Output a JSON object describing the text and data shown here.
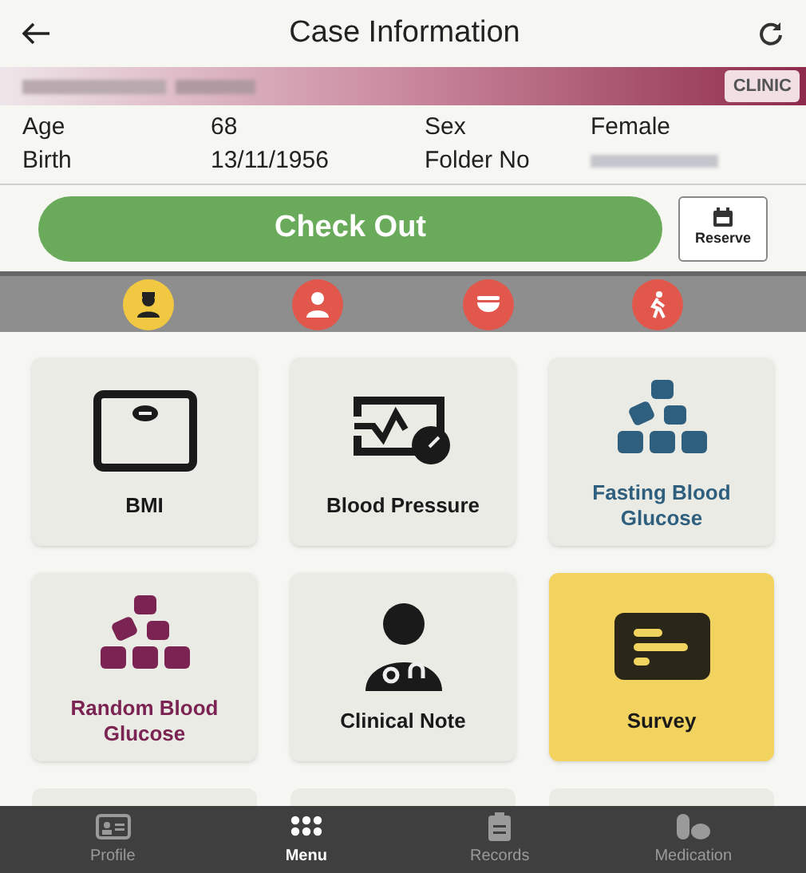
{
  "header": {
    "title": "Case Information"
  },
  "patient": {
    "badge": "CLINIC",
    "fields": [
      {
        "label": "Age",
        "value": "68"
      },
      {
        "label": "Sex",
        "value": "Female"
      },
      {
        "label": "Birth",
        "value": "13/11/1956"
      },
      {
        "label": "Folder No",
        "redacted": true
      }
    ]
  },
  "actions": {
    "primary": "Check Out",
    "secondary": "Reserve"
  },
  "categories": [
    {
      "kind": "nurse",
      "selected": true
    },
    {
      "kind": "doctor",
      "selected": false
    },
    {
      "kind": "food",
      "selected": false
    },
    {
      "kind": "walk",
      "selected": false
    }
  ],
  "tiles": [
    {
      "kind": "scale",
      "label": "BMI",
      "color": "#1a1a1a",
      "selected": false
    },
    {
      "kind": "monitor",
      "label": "Blood Pressure",
      "color": "#1a1a1a",
      "selected": false
    },
    {
      "kind": "cubes",
      "label": "Fasting Blood Glucose",
      "color": "#2f5f7e",
      "selected": false
    },
    {
      "kind": "cubes",
      "label": "Random Blood Glucose",
      "color": "#7b2352",
      "selected": false
    },
    {
      "kind": "doctor",
      "label": "Clinical Note",
      "color": "#1a1a1a",
      "selected": false
    },
    {
      "kind": "survey",
      "label": "Survey",
      "color": "#1a1a1a",
      "selected": true
    }
  ],
  "nav": [
    {
      "kind": "profile",
      "label": "Profile",
      "selected": false
    },
    {
      "kind": "menu",
      "label": "Menu",
      "selected": true
    },
    {
      "kind": "records",
      "label": "Records",
      "selected": false
    },
    {
      "kind": "medication",
      "label": "Medication",
      "selected": false
    }
  ]
}
